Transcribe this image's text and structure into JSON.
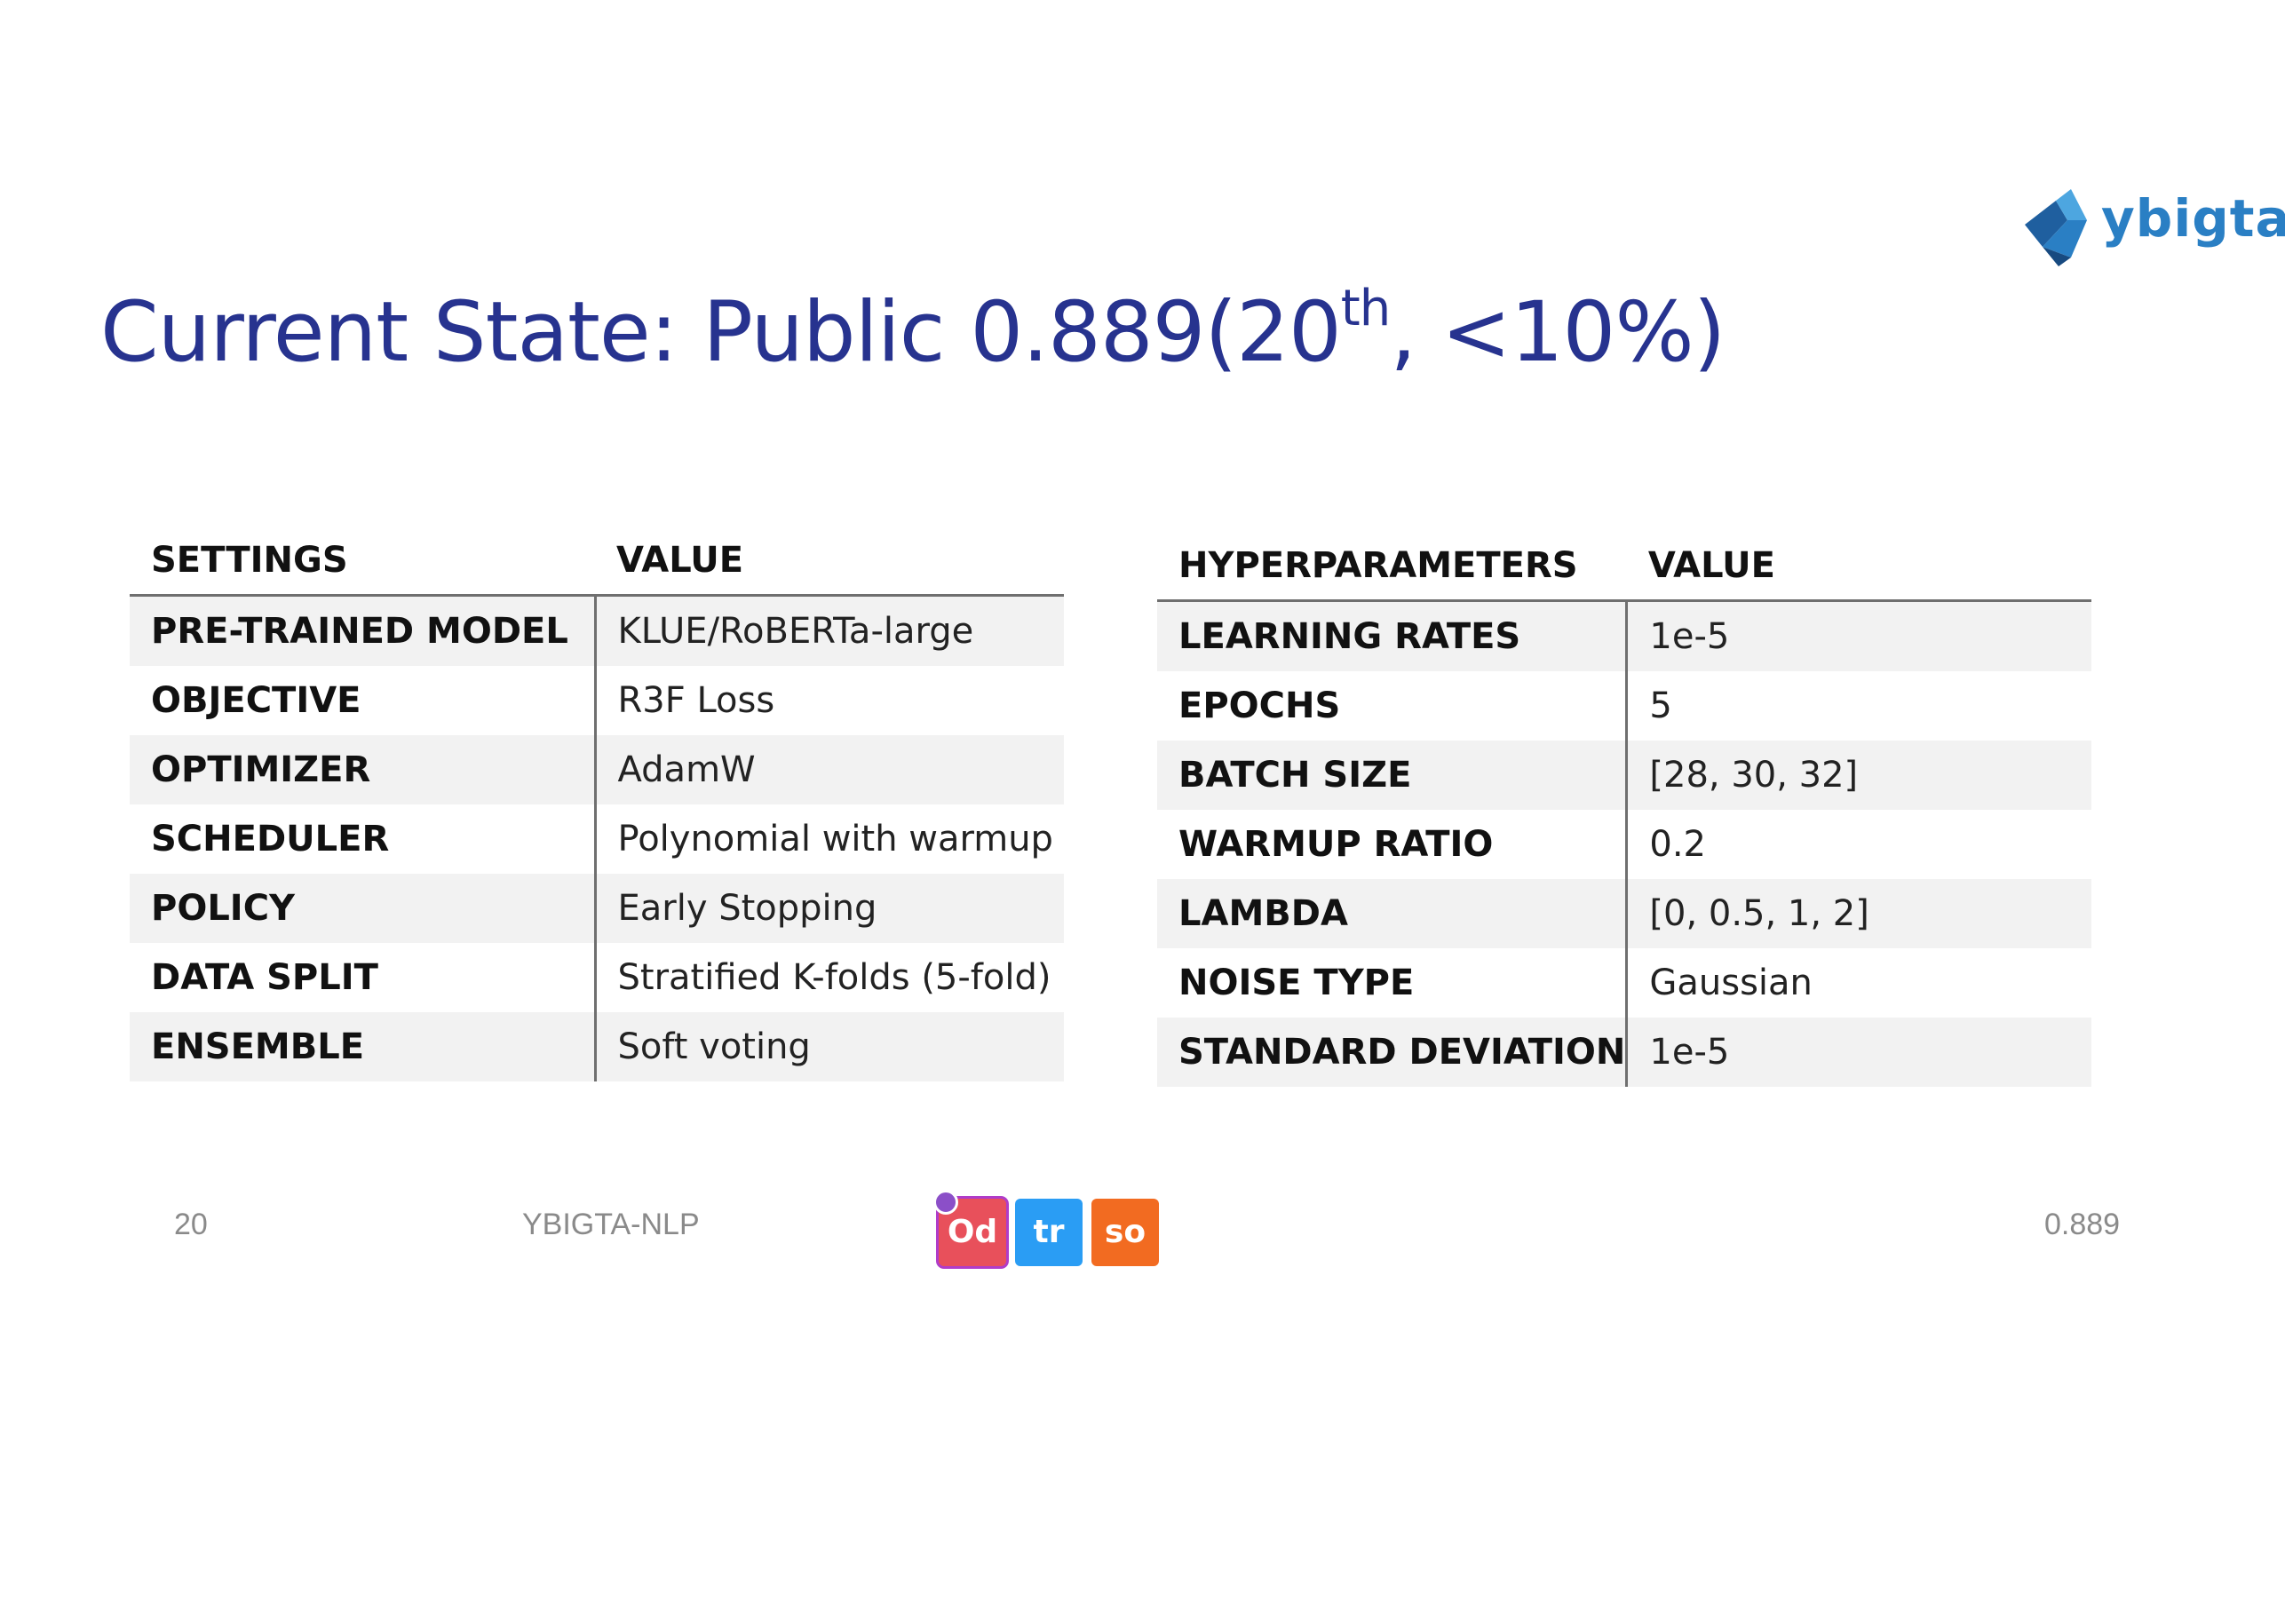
{
  "logo": {
    "text": "ybigta",
    "colors": {
      "dark": "#1f5f9f",
      "mid": "#2a7fc4",
      "light": "#4da6e0"
    }
  },
  "title": {
    "main": "Current State: Public 0.889(20",
    "sup": "th",
    "tail": ", <10%)",
    "color": "#27338f"
  },
  "settings_table": {
    "headers": [
      "SETTINGS",
      "VALUE"
    ],
    "rows": [
      [
        "PRE-TRAINED MODEL",
        "KLUE/RoBERTa-large"
      ],
      [
        "OBJECTIVE",
        "R3F Loss"
      ],
      [
        "OPTIMIZER",
        "AdamW"
      ],
      [
        "SCHEDULER",
        "Polynomial with warmup"
      ],
      [
        "POLICY",
        "Early Stopping"
      ],
      [
        "DATA SPLIT",
        "Stratified K-folds (5-fold)"
      ],
      [
        "ENSEMBLE",
        "Soft voting"
      ]
    ]
  },
  "hyper_table": {
    "headers": [
      "HYPERPARAMETERS",
      "VALUE"
    ],
    "rows": [
      [
        "LEARNING RATES",
        "1e-5"
      ],
      [
        "EPOCHS",
        "5"
      ],
      [
        "BATCH SIZE",
        "[28, 30, 32]"
      ],
      [
        "WARMUP RATIO",
        "0.2"
      ],
      [
        "LAMBDA",
        "[0, 0.5, 1, 2]"
      ],
      [
        "NOISE TYPE",
        "Gaussian"
      ],
      [
        "STANDARD DEVIATION",
        "1e-5"
      ]
    ]
  },
  "leaderboard": {
    "rank": "20",
    "team": "YBIGTA-NLP",
    "members": [
      {
        "initials": "Od",
        "color": "#e8505b"
      },
      {
        "initials": "tr",
        "color": "#2a9df4"
      },
      {
        "initials": "so",
        "color": "#f26b21"
      }
    ],
    "score": "0.889"
  }
}
